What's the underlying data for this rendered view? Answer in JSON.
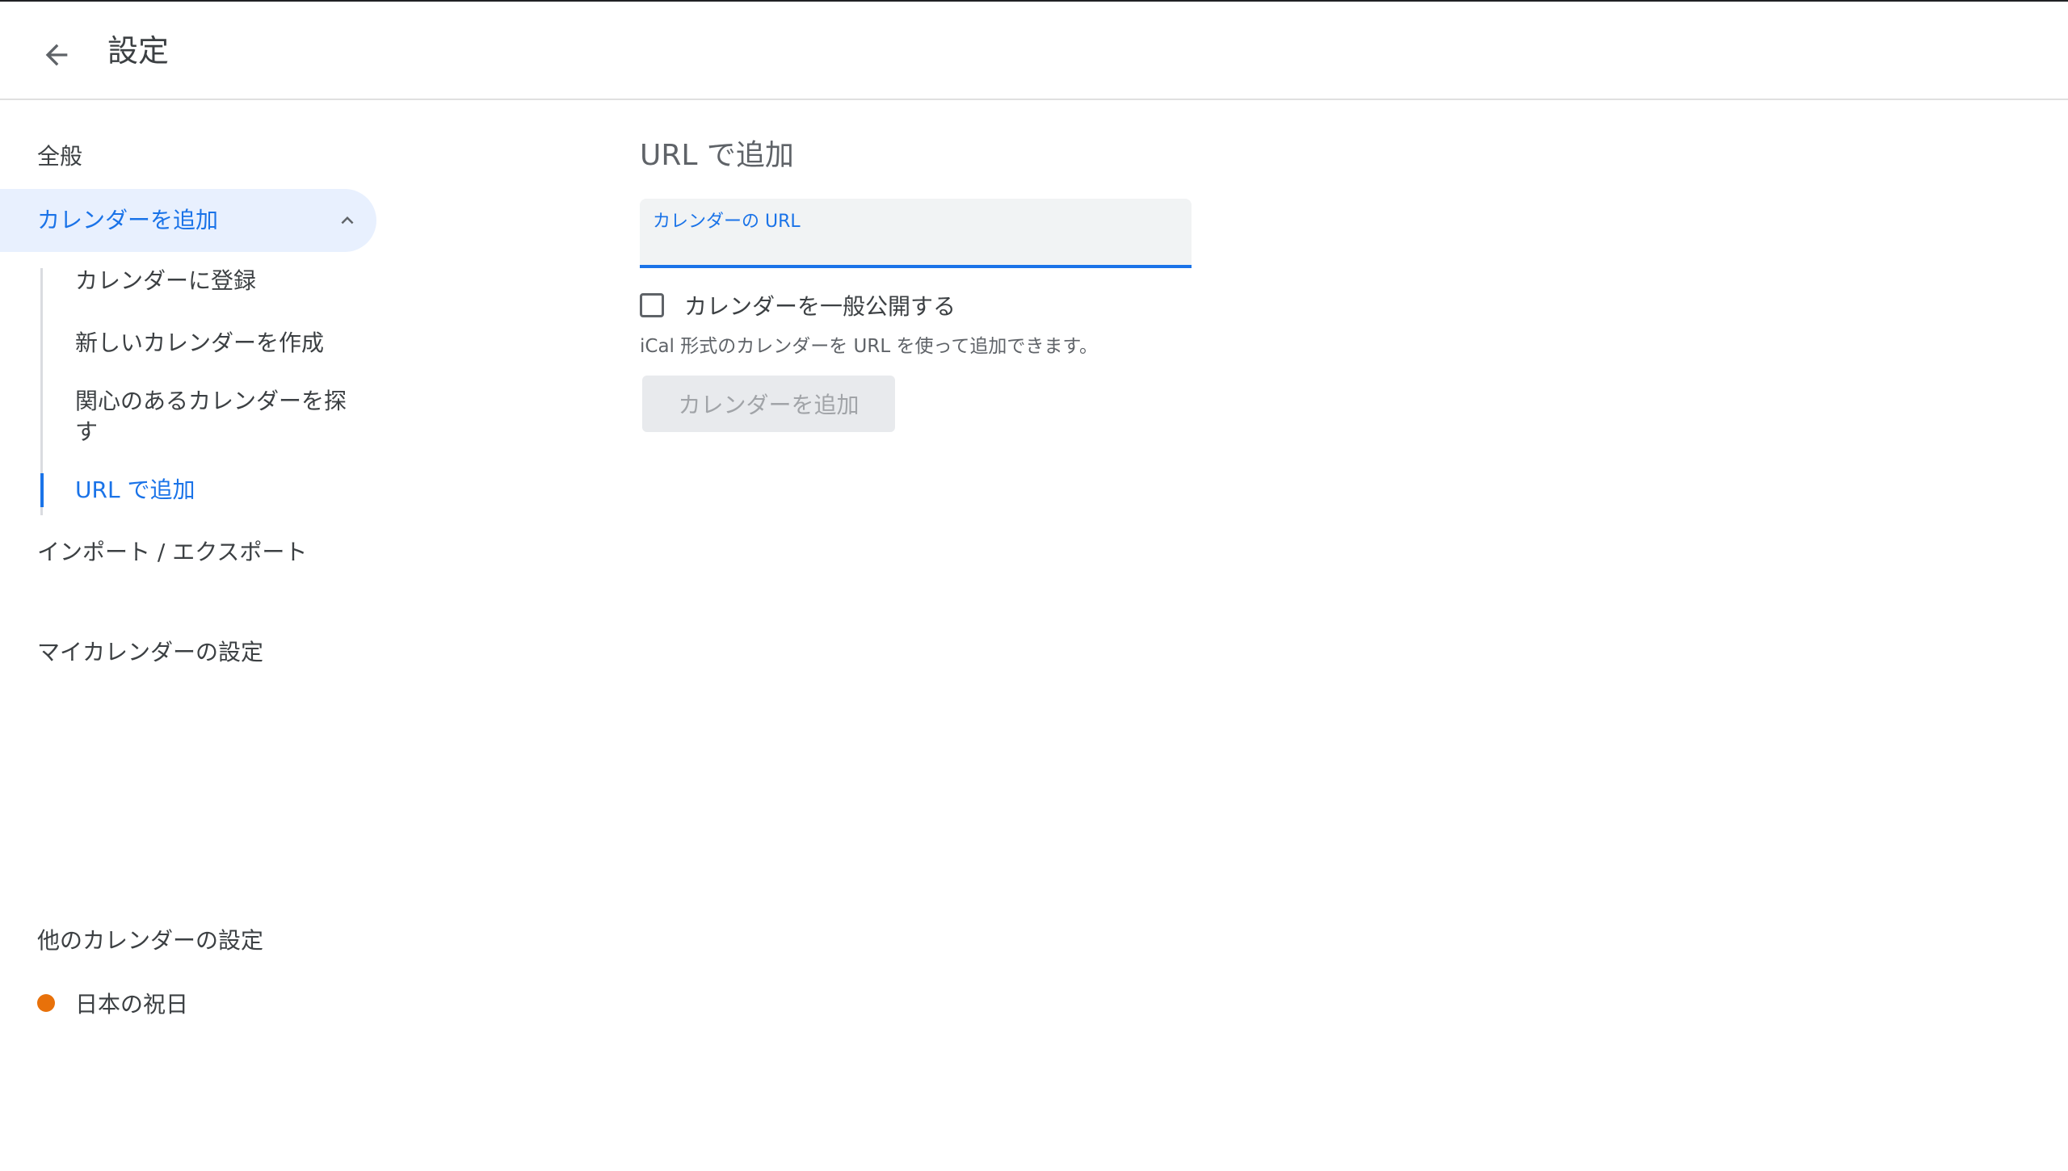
{
  "header": {
    "title": "設定",
    "back_icon": "arrow-back-icon"
  },
  "sidebar": {
    "general": "全般",
    "add_calendar": {
      "label": "カレンダーを追加",
      "expanded": true,
      "items": [
        {
          "label": "カレンダーに登録",
          "active": false
        },
        {
          "label": "新しいカレンダーを作成",
          "active": false
        },
        {
          "label": "関心のあるカレンダーを探す",
          "active": false
        },
        {
          "label": "URL で追加",
          "active": true
        }
      ]
    },
    "import_export": "インポート / エクスポート",
    "my_calendars_title": "マイカレンダーの設定",
    "other_calendars_title": "他のカレンダーの設定",
    "other_calendars": [
      {
        "label": "日本の祝日",
        "color": "#e8710a"
      }
    ]
  },
  "main": {
    "heading": "URL で追加",
    "url_field": {
      "label": "カレンダーの URL",
      "value": ""
    },
    "public_checkbox": {
      "label": "カレンダーを一般公開する",
      "checked": false
    },
    "helper": "iCal 形式のカレンダーを URL を使って追加できます。",
    "add_button": "カレンダーを追加",
    "add_button_enabled": false
  },
  "colors": {
    "accent": "#1a73e8",
    "active_bg": "#e8f0fe",
    "holiday_dot": "#e8710a"
  }
}
